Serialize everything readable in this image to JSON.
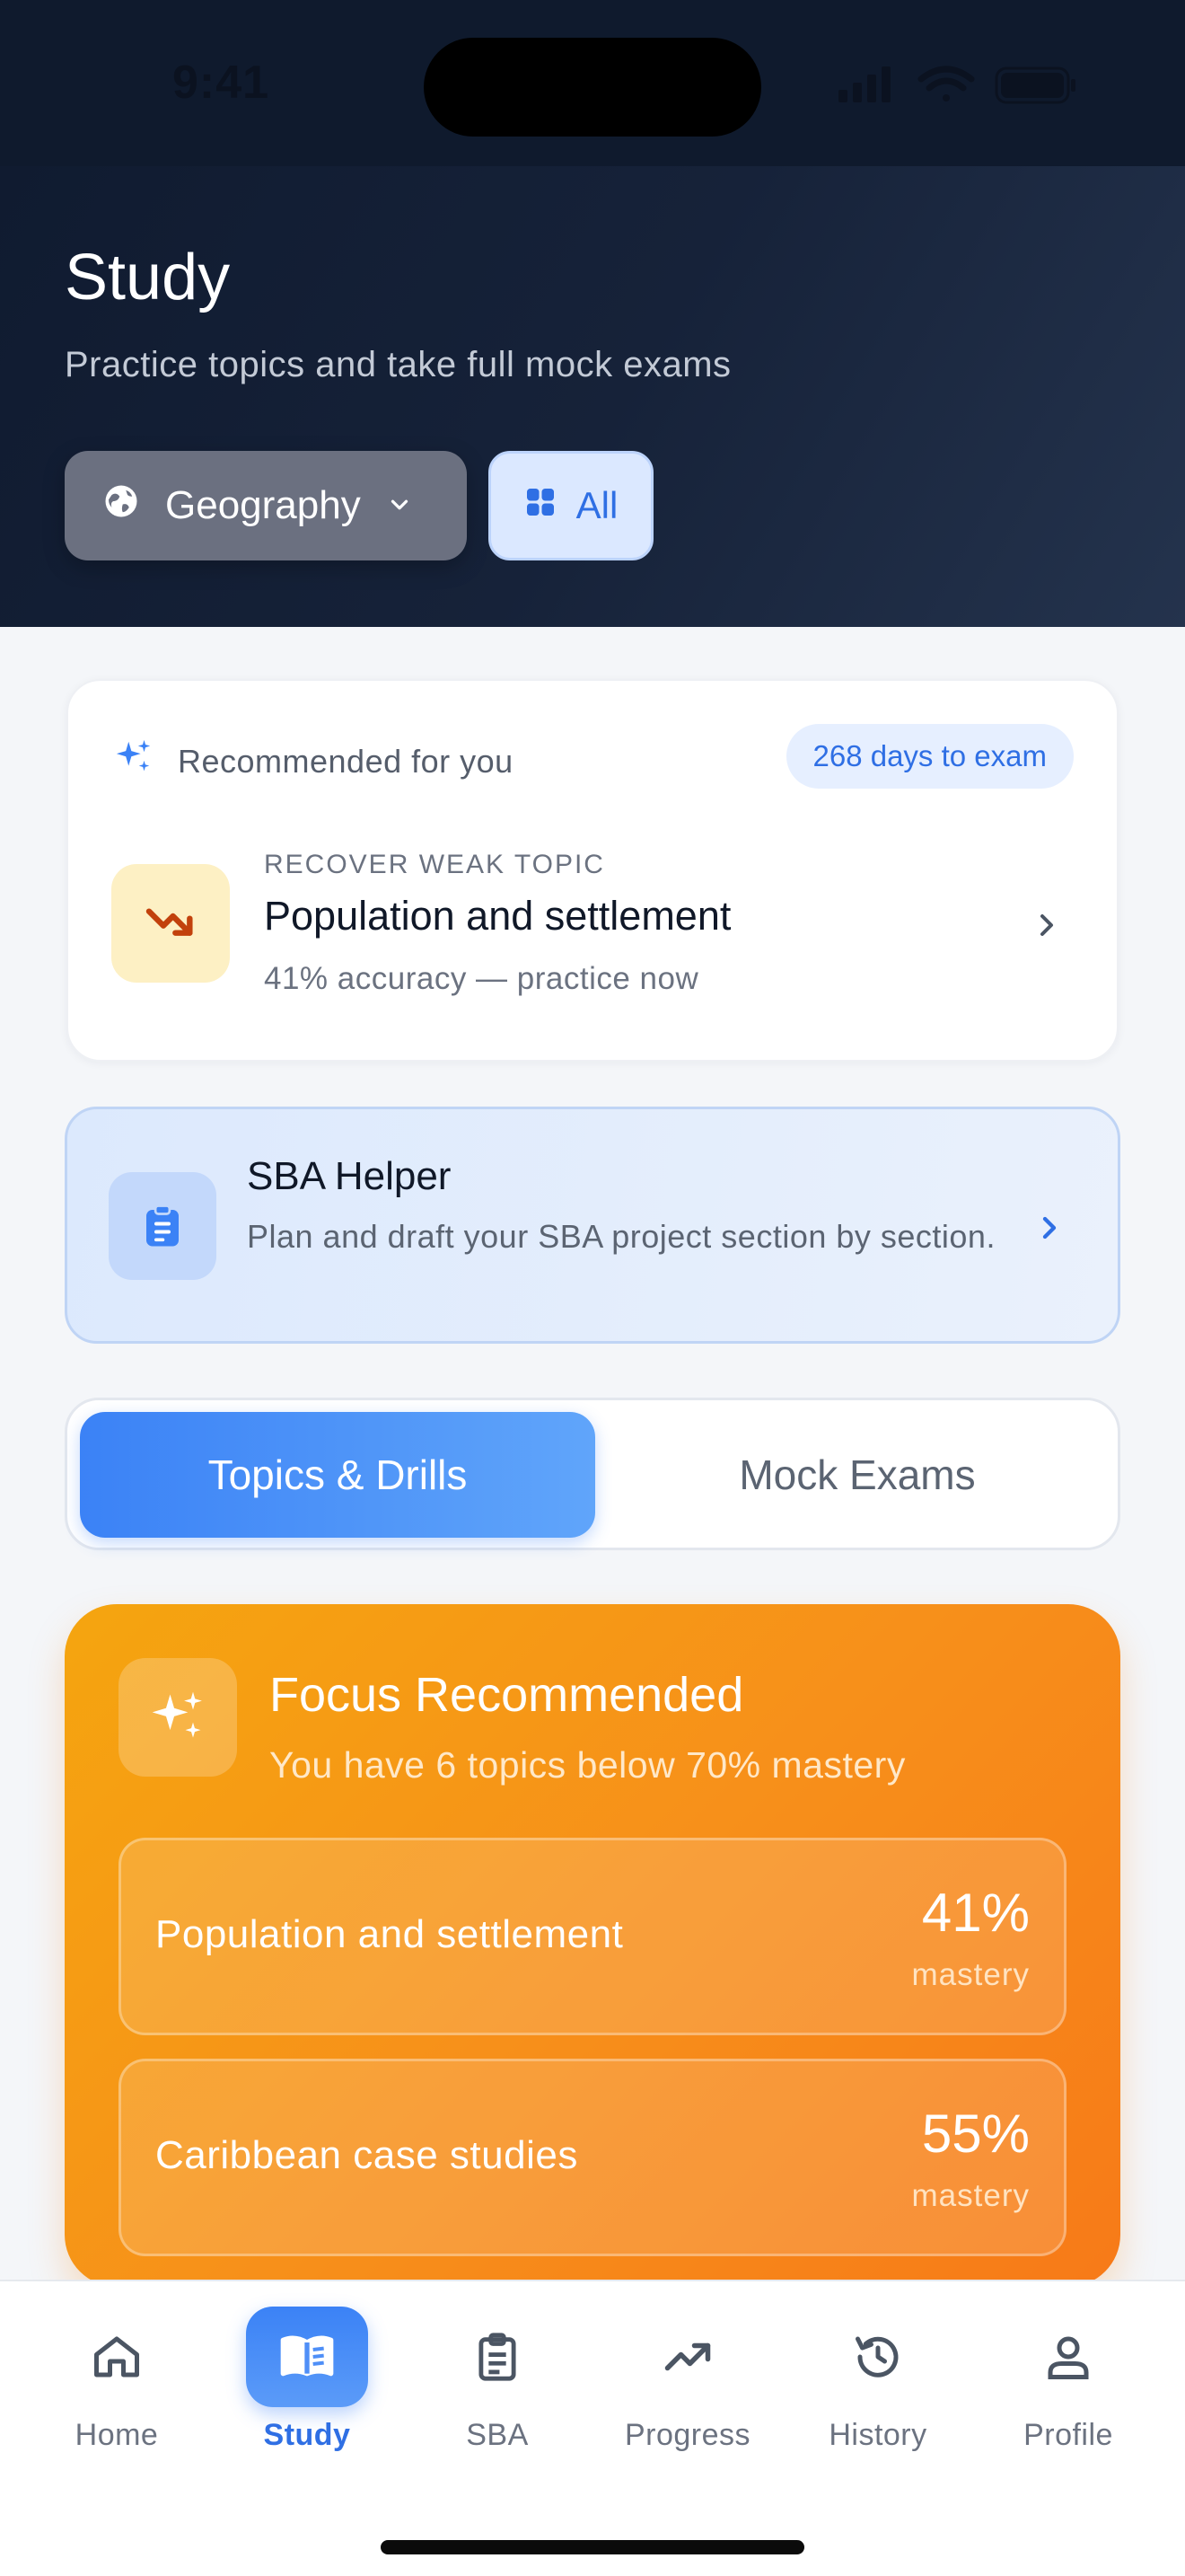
{
  "status_bar": {
    "time": "9:41"
  },
  "header": {
    "title": "Study",
    "subtitle": "Practice topics and take full mock exams",
    "subject_selector": {
      "value": "Geography",
      "icon": "globe-icon"
    },
    "filter_button": {
      "label": "All",
      "icon": "grid-icon"
    }
  },
  "recommended": {
    "heading": "Recommended for you",
    "days_badge": "268 days to exam",
    "kicker": "RECOVER WEAK TOPIC",
    "topic_title": "Population and settlement",
    "detail": "41% accuracy — practice now"
  },
  "sba_helper": {
    "title": "SBA Helper",
    "description": "Plan and draft your SBA project section by section."
  },
  "segmented": {
    "tabs": [
      {
        "label": "Topics & Drills",
        "active": true
      },
      {
        "label": "Mock Exams",
        "active": false
      }
    ]
  },
  "focus": {
    "title": "Focus Recommended",
    "subtitle": "You have 6 topics below 70% mastery",
    "topics": [
      {
        "name": "Population and settlement",
        "percent": "41%",
        "unit": "mastery"
      },
      {
        "name": "Caribbean case studies",
        "percent": "55%",
        "unit": "mastery"
      }
    ]
  },
  "tab_bar": {
    "items": [
      {
        "label": "Home",
        "icon": "home-icon"
      },
      {
        "label": "Study",
        "icon": "book-icon",
        "active": true
      },
      {
        "label": "SBA",
        "icon": "clipboard-icon"
      },
      {
        "label": "Progress",
        "icon": "trend-icon"
      },
      {
        "label": "History",
        "icon": "history-icon"
      },
      {
        "label": "Profile",
        "icon": "user-icon"
      }
    ]
  },
  "colors": {
    "header_bg": "#131e33",
    "accent": "#3b82f6",
    "focus_orange": "#f7901a",
    "weak_icon_bg": "#fdf0c4"
  }
}
